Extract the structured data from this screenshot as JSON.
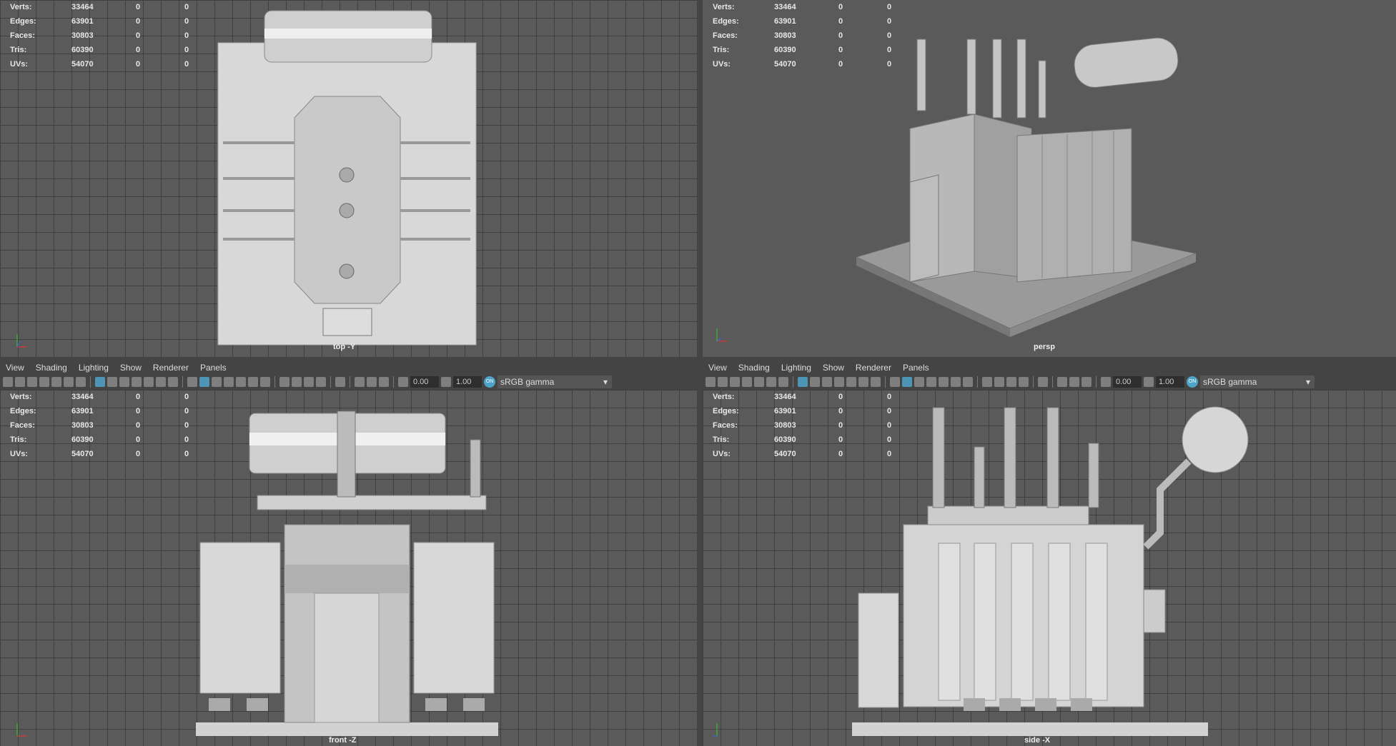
{
  "stats": [
    {
      "label": "Verts:",
      "value": "33464",
      "a": "0",
      "b": "0"
    },
    {
      "label": "Edges:",
      "value": "63901",
      "a": "0",
      "b": "0"
    },
    {
      "label": "Faces:",
      "value": "30803",
      "a": "0",
      "b": "0"
    },
    {
      "label": "Tris:",
      "value": "60390",
      "a": "0",
      "b": "0"
    },
    {
      "label": "UVs:",
      "value": "54070",
      "a": "0",
      "b": "0"
    }
  ],
  "viewports": {
    "top": "top -Y",
    "persp": "persp",
    "front": "front -Z",
    "side": "side -X"
  },
  "menu": [
    "View",
    "Shading",
    "Lighting",
    "Show",
    "Renderer",
    "Panels"
  ],
  "toolbar": {
    "exposure": "0.00",
    "gamma": "1.00",
    "color_mgmt": "ON",
    "color_space": "sRGB gamma"
  }
}
